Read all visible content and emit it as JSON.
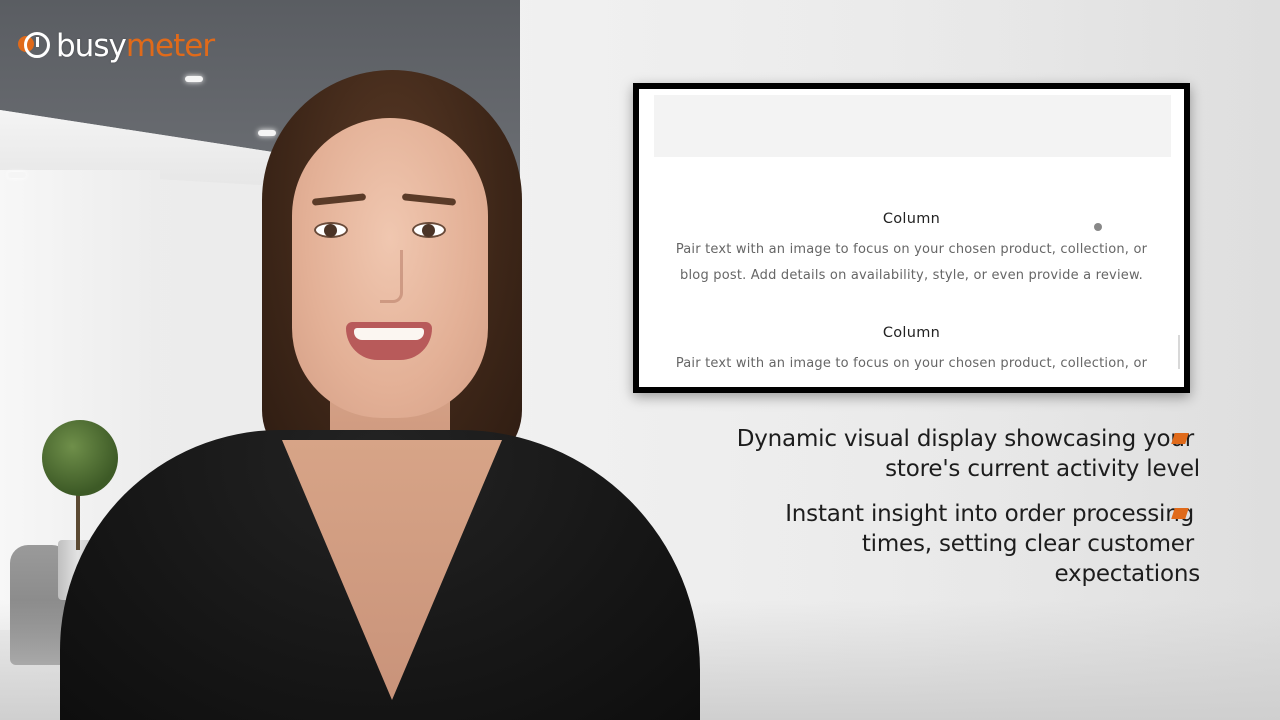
{
  "logo": {
    "part1": "busy",
    "part2": "meter",
    "lead_letter_hidden": "b"
  },
  "screen": {
    "columns": [
      {
        "title": "Column",
        "text_line1": "Pair text with an image to focus on your chosen product, collection, or",
        "text_line2": "blog post. Add details on availability, style, or even provide a review."
      },
      {
        "title": "Column",
        "text_line1": "Pair text with an image to focus on your chosen product, collection, or"
      }
    ]
  },
  "bullets": [
    {
      "line1": "Dynamic visual display showcasing your",
      "line2": "store's current activity level"
    },
    {
      "line1": "Instant insight into order processing",
      "line2": "times, setting clear customer",
      "line3": "expectations"
    }
  ],
  "colors": {
    "accent": "#e06a1a",
    "text": "#1d1d1d",
    "monitor_frame": "#000000"
  }
}
